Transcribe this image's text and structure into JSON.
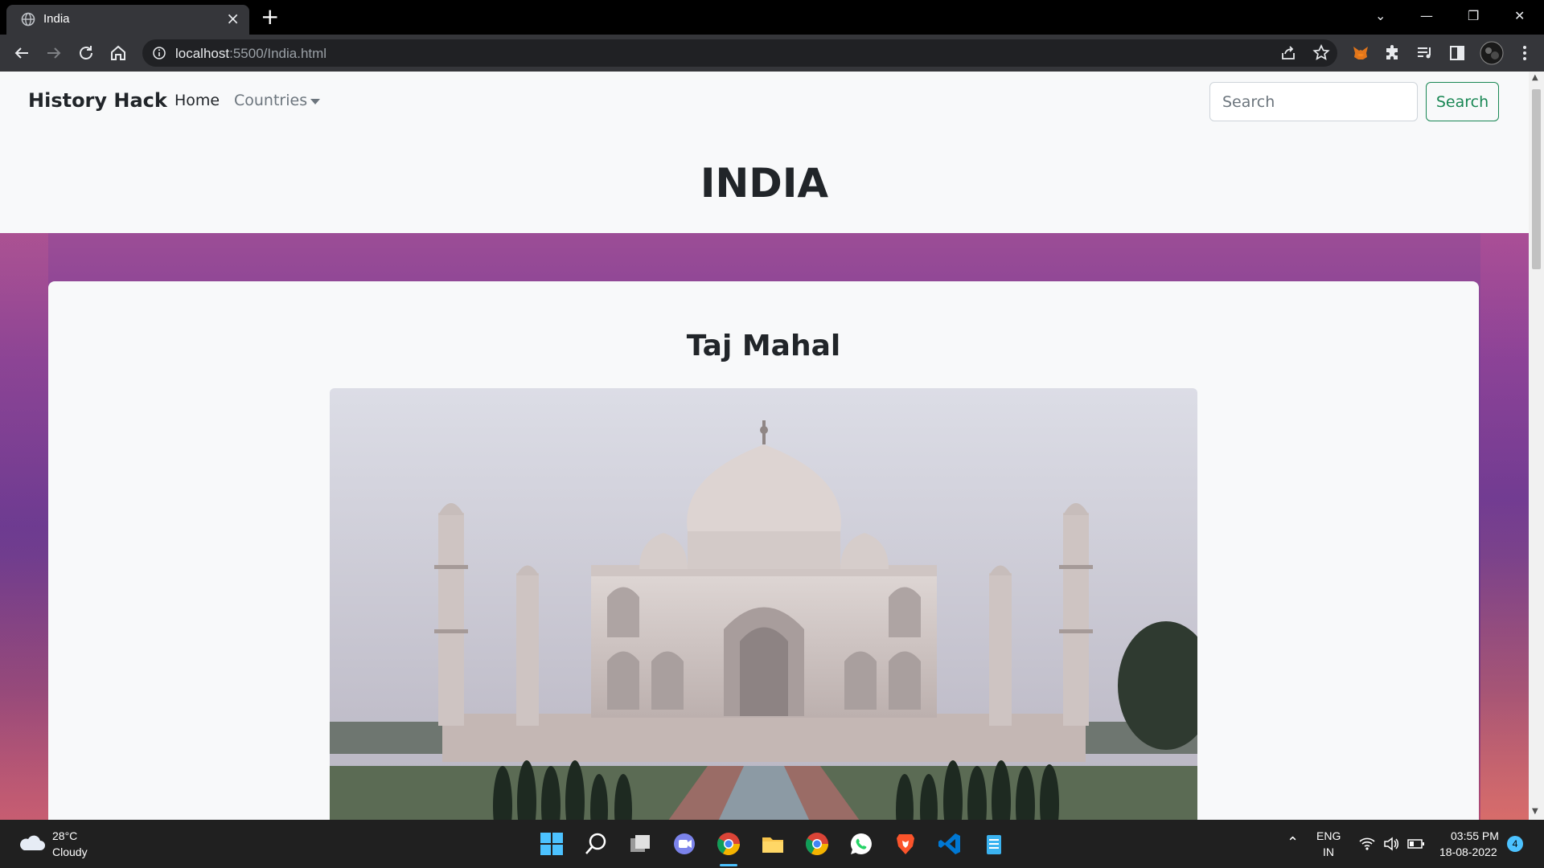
{
  "browser": {
    "tab_title": "India",
    "url_host": "localhost",
    "url_rest": ":5500/India.html"
  },
  "navbar": {
    "brand": "History Hack",
    "home": "Home",
    "countries": "Countries",
    "search_placeholder": "Search",
    "search_button": "Search"
  },
  "page": {
    "heading": "INDIA",
    "card_title": "Taj Mahal"
  },
  "taskbar": {
    "weather_temp": "28°C",
    "weather_desc": "Cloudy",
    "lang_line1": "ENG",
    "lang_line2": "IN",
    "time": "03:55 PM",
    "date": "18-08-2022",
    "notifications": "4"
  },
  "colors": {
    "success": "#198754",
    "navbar_bg": "#f8f9fa",
    "background_purple": "#7f3f97"
  }
}
